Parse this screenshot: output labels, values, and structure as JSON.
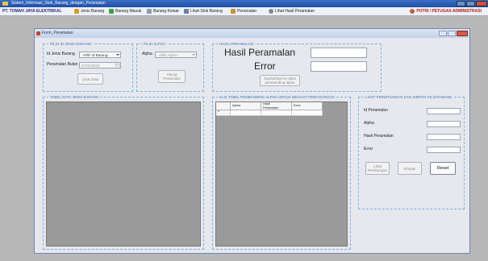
{
  "window": {
    "title": "Sistem_Informasi_Stok_Barang_dengan_Peramalan"
  },
  "menubar": {
    "company": "PT. TOMAH JAYA ELEKTRIKAL",
    "items": [
      {
        "label": "Jenis Barang",
        "icon": "box-icon",
        "color": "#d89b2a"
      },
      {
        "label": "Barang Masuk",
        "icon": "inbox-icon",
        "color": "#3aa04a"
      },
      {
        "label": "Barang Keluar",
        "icon": "outbox-icon",
        "color": "#8a9bb5"
      },
      {
        "label": "Lihat Stok Barang",
        "icon": "list-icon",
        "color": "#6a7fa8"
      },
      {
        "label": "Peramalan",
        "icon": "forecast-icon",
        "color": "#c89030"
      },
      {
        "label": "Lihat Hasil Peramalan",
        "icon": "magnifier-icon",
        "color": "#7a8aa0"
      }
    ],
    "user": "PUTRI / PETUGAS ADMINISTRASI",
    "user_icon": "user-icon"
  },
  "form": {
    "title": "Form_Peramalan",
    "pilih_jenis": {
      "legend": "PILIH ID JENIS BARANG",
      "id_label": "Id Jenis Barang",
      "id_value": "--Pilih Id Barang--",
      "bulan_label": "Peramalan Bulan",
      "bulan_value": "27/07/2019",
      "lihat_button": "Lihat Data"
    },
    "pilih_alpha": {
      "legend": "PILIH ALPHA",
      "alpha_label": "Alpha",
      "alpha_value": "--Pilih Alpha--",
      "hitung_button_l1": "Hitung",
      "hitung_button_l2": "Peramalan"
    },
    "hasil": {
      "legend": "HASIL PERAMALAN",
      "hasil_label": "Hasil Peramalan",
      "error_label": "Error",
      "tambah_l1": "Tambahkan ke tabel",
      "tambah_l2": "pembanding alpha"
    },
    "tabel_jenis": {
      "legend": "TABEL DATA JENIS BARANG"
    },
    "tabel_alpha": {
      "legend": "KLIK TABEL PEMBANDING ALPHA UNTUK MELIHAT PERHITUNGAN",
      "columns": [
        "Alpha",
        "Hasil\nPeramalan",
        "Error"
      ],
      "new_row_marker": "*"
    },
    "lihat_simpan": {
      "legend": "LIHAT PERHITUNGAN DAN SIMPAN KE DATABASE",
      "id_peramalan": "Id Peramalan",
      "alpha": "Alpha",
      "hasil_peramalan": "Hasil Peramalan",
      "error": "Error",
      "lihat_l1": "Lihat",
      "lihat_l2": "Perhitungan",
      "simpan": "Simpan",
      "reset": "Reset"
    }
  }
}
